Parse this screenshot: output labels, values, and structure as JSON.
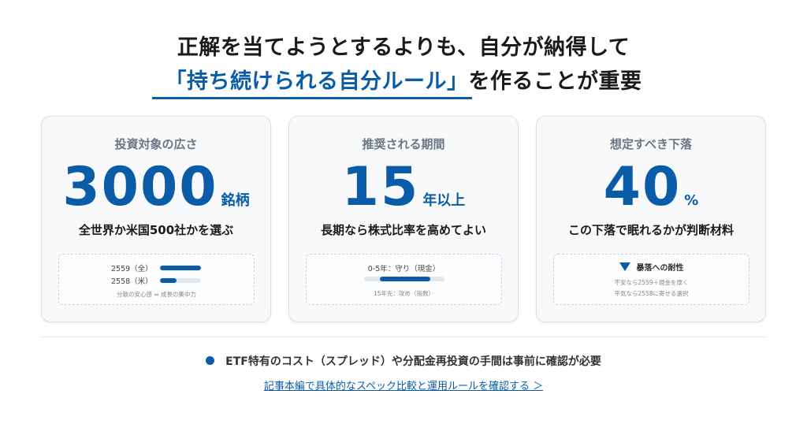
{
  "headline": {
    "line1": "正解を当てようとするよりも、自分が納得して",
    "line2_accent": "「持ち続けられる自分ルール」",
    "line2_rest": "を作ることが重要"
  },
  "cards": [
    {
      "title": "投資対象の広さ",
      "value": "3000",
      "unit": "銘柄",
      "subtitle": "全世界か米国500社かを選ぶ",
      "bars": [
        {
          "label": "2559（全）",
          "fill": 1.0
        },
        {
          "label": "2558（米）",
          "fill": 0.4
        }
      ],
      "note": "分散の安心感 ⇔ 成長の集中力"
    },
    {
      "title": "推奨される期間",
      "value": "15",
      "unit": "年以上",
      "subtitle": "長期なら株式比率を高めてよい",
      "bar_label": "0-5年：守り（現金）",
      "bar_fill": 0.8,
      "note": "15年先：攻め（指数）"
    },
    {
      "title": "想定すべき下落",
      "value": "40",
      "unit": "%",
      "subtitle": "この下落で眠れるかが判断材料",
      "inner_title": "暴落への耐性",
      "line_a": "不安なら2559＋現金を厚く",
      "line_b": "平気なら2558に寄せる選択"
    }
  ],
  "footer": {
    "note": "ETF特有のコスト（スプレッド）や分配金再投資の手間は事前に確認が必要",
    "link": "記事本編で具体的なスペック比較と運用ルールを確認する ＞"
  },
  "colors": {
    "accent": "#0a5ca8",
    "card_bg": "#f7f9fb",
    "card_border": "#d9e1ea"
  }
}
